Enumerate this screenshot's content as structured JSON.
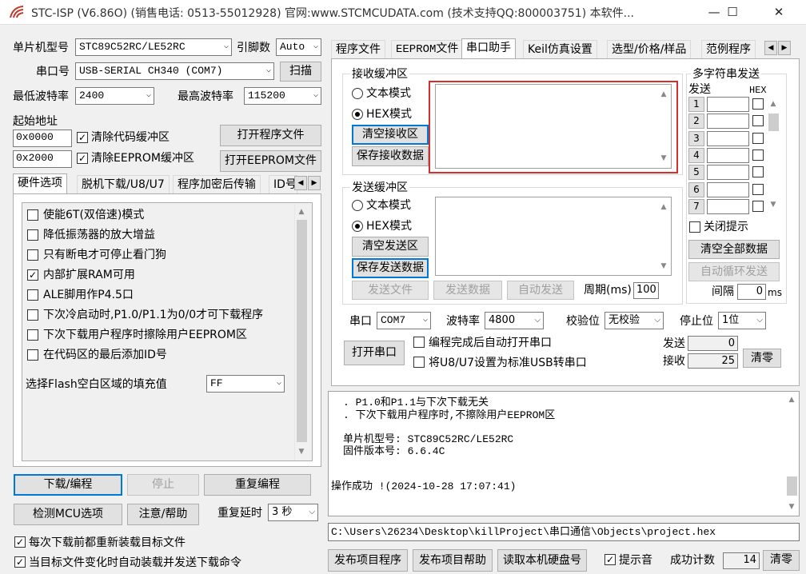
{
  "window": {
    "title": "STC-ISP (V6.86O) (销售电话: 0513-55012928) 官网:www.STCMCUDATA.com  (技术支持QQ:800003751) 本软件...",
    "minimize": "—",
    "maximize": "☐",
    "close": "✕"
  },
  "left": {
    "mcu_type_label": "单片机型号",
    "mcu_type_value": "STC89C52RC/LE52RC",
    "pin_label": "引脚数",
    "pin_value": "Auto",
    "port_label": "串口号",
    "port_value": "USB-SERIAL CH340 (COM7)",
    "scan_button": "扫描",
    "min_baud_label": "最低波特率",
    "min_baud_value": "2400",
    "max_baud_label": "最高波特率",
    "max_baud_value": "115200",
    "start_addr_label": "起始地址",
    "code_addr": "0x0000",
    "clear_code_label": "清除代码缓冲区",
    "open_program_button": "打开程序文件",
    "eeprom_addr": "0x2000",
    "clear_eeprom_label": "清除EEPROM缓冲区",
    "open_eeprom_button": "打开EEPROM文件",
    "tabs": [
      "硬件选项",
      "脱机下载/U8/U7",
      "程序加密后传输",
      "ID号"
    ],
    "options": [
      {
        "label": "使能6T(双倍速)模式",
        "checked": false
      },
      {
        "label": "降低振荡器的放大增益",
        "checked": false
      },
      {
        "label": "只有断电才可停止看门狗",
        "checked": false
      },
      {
        "label": "内部扩展RAM可用",
        "checked": true
      },
      {
        "label": "ALE脚用作P4.5口",
        "checked": false
      },
      {
        "label": "下次冷启动时,P1.0/P1.1为0/0才可下载程序",
        "checked": false
      },
      {
        "label": "下次下载用户程序时擦除用户EEPROM区",
        "checked": false
      },
      {
        "label": "在代码区的最后添加ID号",
        "checked": false
      }
    ],
    "flash_fill_label": "选择Flash空白区域的填充值",
    "flash_fill_value": "FF",
    "download_button": "下载/编程",
    "stop_button": "停止",
    "reprogram_button": "重复编程",
    "detect_button": "检测MCU选项",
    "help_button": "注意/帮助",
    "repeat_delay_label": "重复延时",
    "repeat_delay_value": "3 秒",
    "reload_label": "每次下载前都重新装载目标文件",
    "autoload_label": "当目标文件变化时自动装载并发送下载命令"
  },
  "right": {
    "tabs": [
      "程序文件",
      "EEPROM文件",
      "串口助手",
      "Keil仿真设置",
      "选型/价格/样品",
      "范例程序"
    ],
    "receive": {
      "title": "接收缓冲区",
      "text_mode": "文本模式",
      "hex_mode": "HEX模式",
      "clear_button": "清空接收区",
      "save_button": "保存接收数据"
    },
    "send": {
      "title": "发送缓冲区",
      "text_mode": "文本模式",
      "hex_mode": "HEX模式",
      "clear_button": "清空发送区",
      "save_button": "保存发送数据",
      "send_file_button": "发送文件",
      "send_data_button": "发送数据",
      "auto_send_button": "自动发送",
      "period_label": "周期(ms)",
      "period_value": "100"
    },
    "multi": {
      "title": "多字符串发送",
      "send_col": "发送",
      "hex_col": "HEX",
      "rows": [
        "1",
        "2",
        "3",
        "4",
        "5",
        "6",
        "7"
      ],
      "close_hint_label": "关闭提示",
      "clear_all_button": "清空全部数据",
      "auto_loop_button": "自动循环发送",
      "interval_label": "间隔",
      "interval_value": "0",
      "interval_unit": "ms"
    },
    "serial": {
      "port_label": "串口",
      "port_value": "COM7",
      "baud_label": "波特率",
      "baud_value": "4800",
      "parity_label": "校验位",
      "parity_value": "无校验",
      "stop_label": "停止位",
      "stop_value": "1位",
      "open_button": "打开串口",
      "auto_open_label": "编程完成后自动打开串口",
      "usb_label": "将U8/U7设置为标准USB转串口",
      "sent_label": "发送",
      "sent_value": "0",
      "recv_label": "接收",
      "recv_value": "25",
      "clear_button": "清零"
    },
    "log": {
      "lines": [
        ". P1.0和P1.1与下次下载无关",
        ". 下次下载用户程序时,不擦除用户EEPROM区"
      ],
      "mcu_line": "单片机型号: STC89C52RC/LE52RC",
      "fw_line": "固件版本号: 6.6.4C",
      "success_line": "操作成功 !(2024-10-28 17:07:41)"
    },
    "path": "C:\\Users\\26234\\Desktop\\killProject\\串口通信\\Objects\\project.hex",
    "bottom": {
      "publish_button": "发布项目程序",
      "publish_help_button": "发布项目帮助",
      "read_disk_button": "读取本机硬盘号",
      "sound_label": "提示音",
      "success_count_label": "成功计数",
      "success_count_value": "14",
      "clear_button": "清零"
    }
  }
}
